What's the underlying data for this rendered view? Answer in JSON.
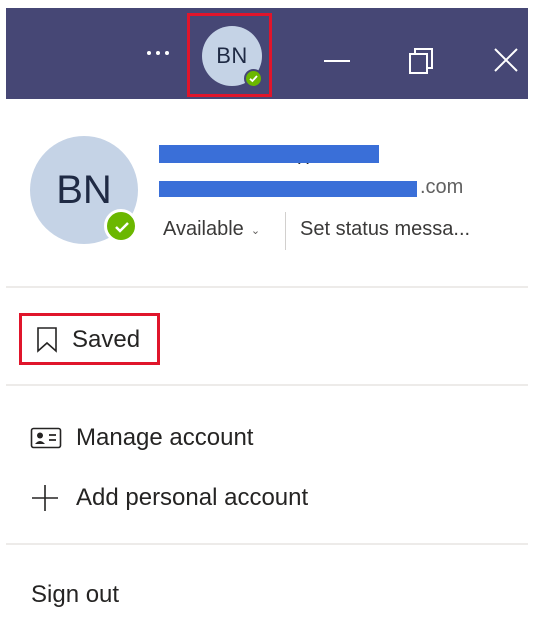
{
  "titlebar": {
    "more_label": "...",
    "avatar_initials": "BN",
    "status_color": "#6bb700",
    "bg_color": "#464775",
    "icons": [
      "more-icon",
      "minimize-icon",
      "restore-icon",
      "close-icon"
    ]
  },
  "profile": {
    "initials": "BN",
    "name_suffix": "( )",
    "email_suffix": ".com",
    "status": "Available",
    "status_message": "Set status messa..."
  },
  "menu": {
    "saved": "Saved",
    "manage_account": "Manage account",
    "add_personal_account": "Add personal account",
    "sign_out": "Sign out"
  },
  "highlight_color": "#e0152b"
}
